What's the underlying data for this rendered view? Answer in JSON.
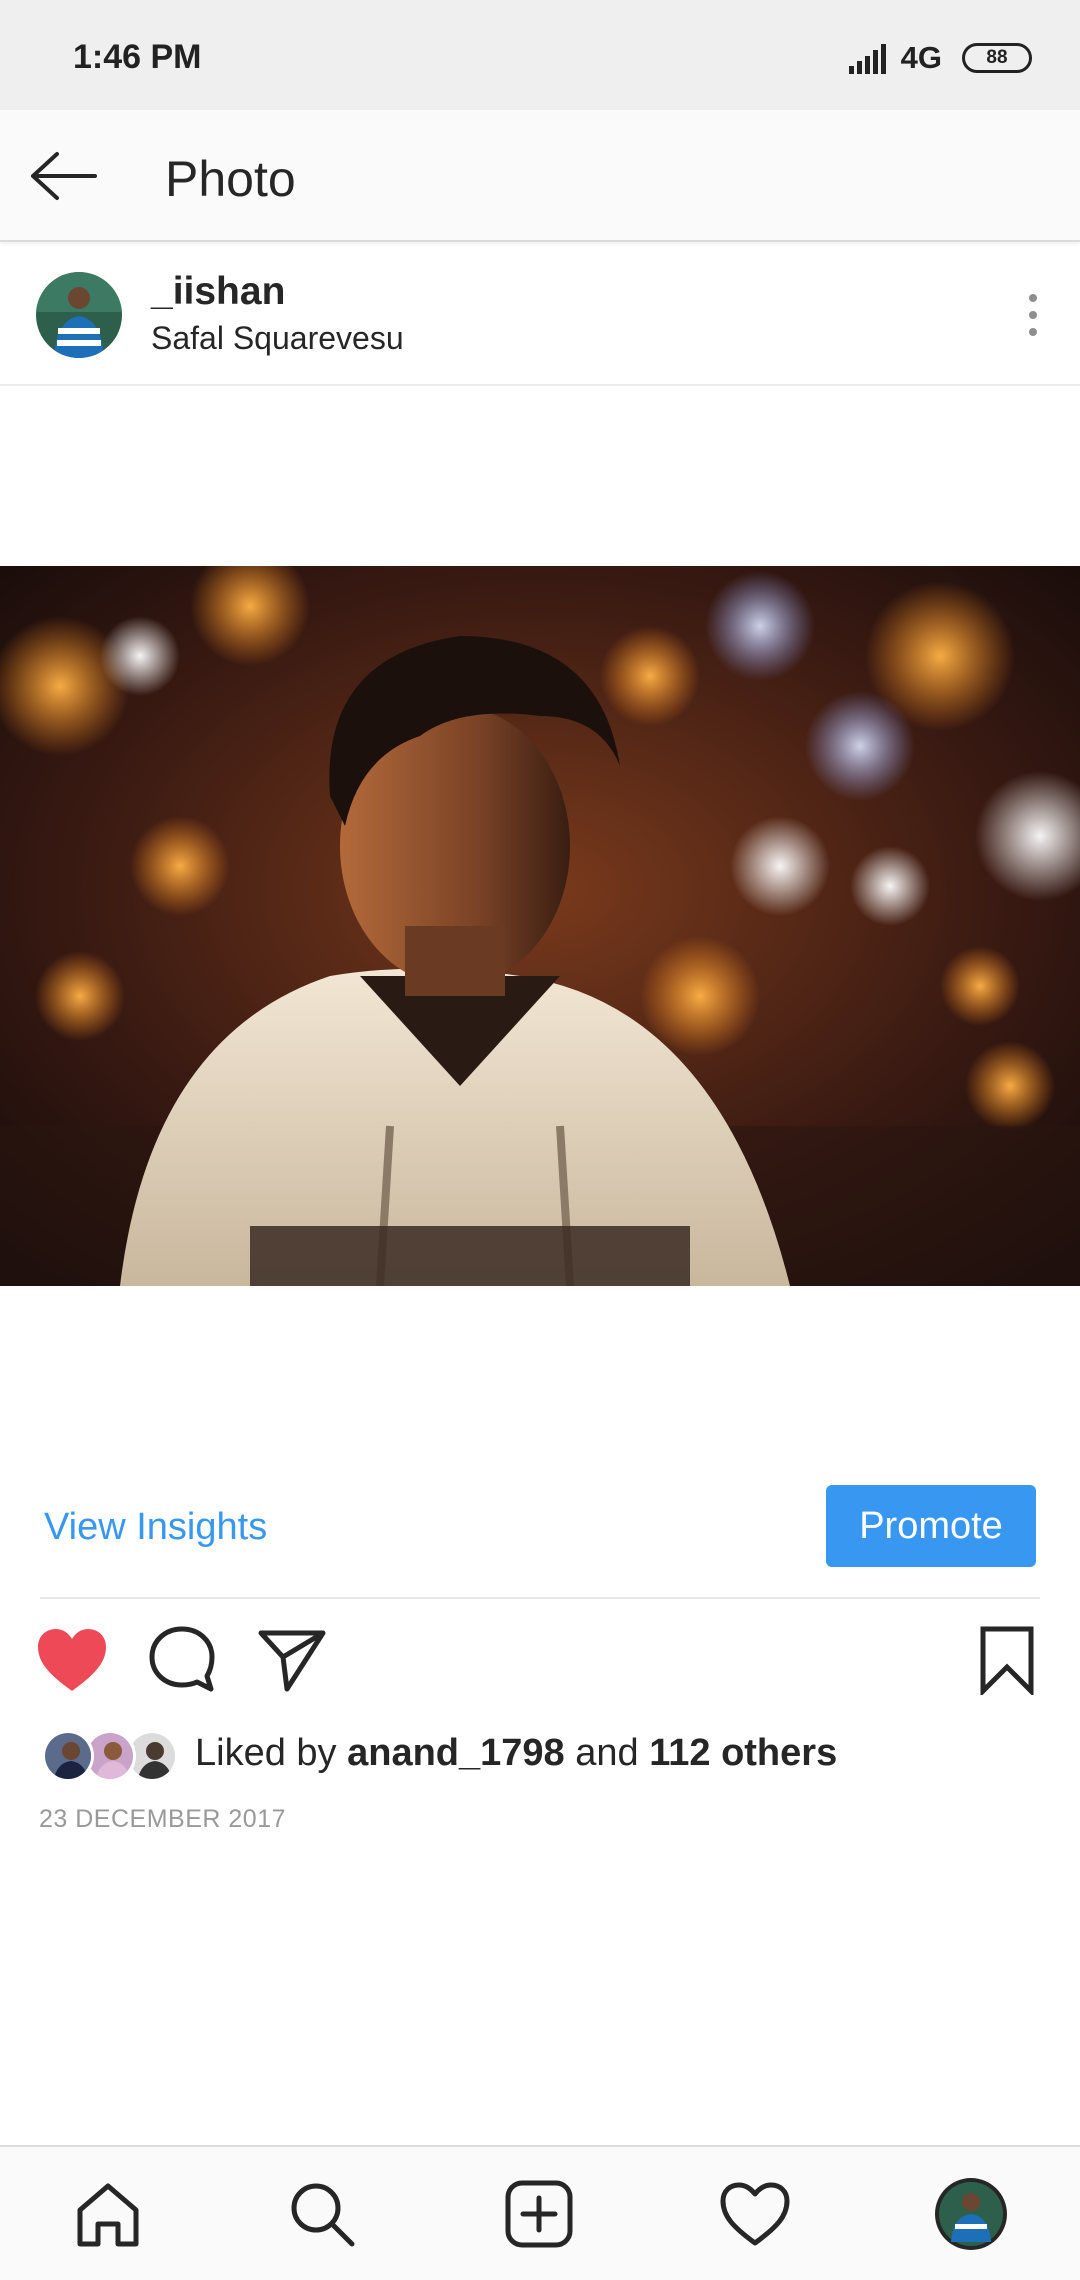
{
  "status_bar": {
    "time": "1:46 PM",
    "network": "4G",
    "network_sub": "",
    "battery": "88"
  },
  "app_bar": {
    "title": "Photo",
    "back_icon": "arrow-left-icon"
  },
  "post": {
    "username": "_iishan",
    "location": "Safal Squarevesu",
    "more_icon": "more-vertical-icon"
  },
  "insights": {
    "view_insights_label": "View Insights",
    "promote_label": "Promote"
  },
  "actions": {
    "like_icon": "heart-filled-icon",
    "comment_icon": "comment-icon",
    "share_icon": "send-icon",
    "save_icon": "bookmark-icon"
  },
  "likes": {
    "prefix": "Liked by ",
    "user": "anand_1798",
    "middle": " and ",
    "others": "112 others"
  },
  "date": "23 DECEMBER 2017",
  "bottom_nav": [
    {
      "icon": "home-icon"
    },
    {
      "icon": "search-icon"
    },
    {
      "icon": "add-post-icon"
    },
    {
      "icon": "activity-heart-icon"
    },
    {
      "icon": "profile-avatar-icon"
    }
  ],
  "colors": {
    "accent": "#3897f0",
    "like_red": "#ed4956",
    "text": "#262626",
    "muted": "#999999"
  }
}
